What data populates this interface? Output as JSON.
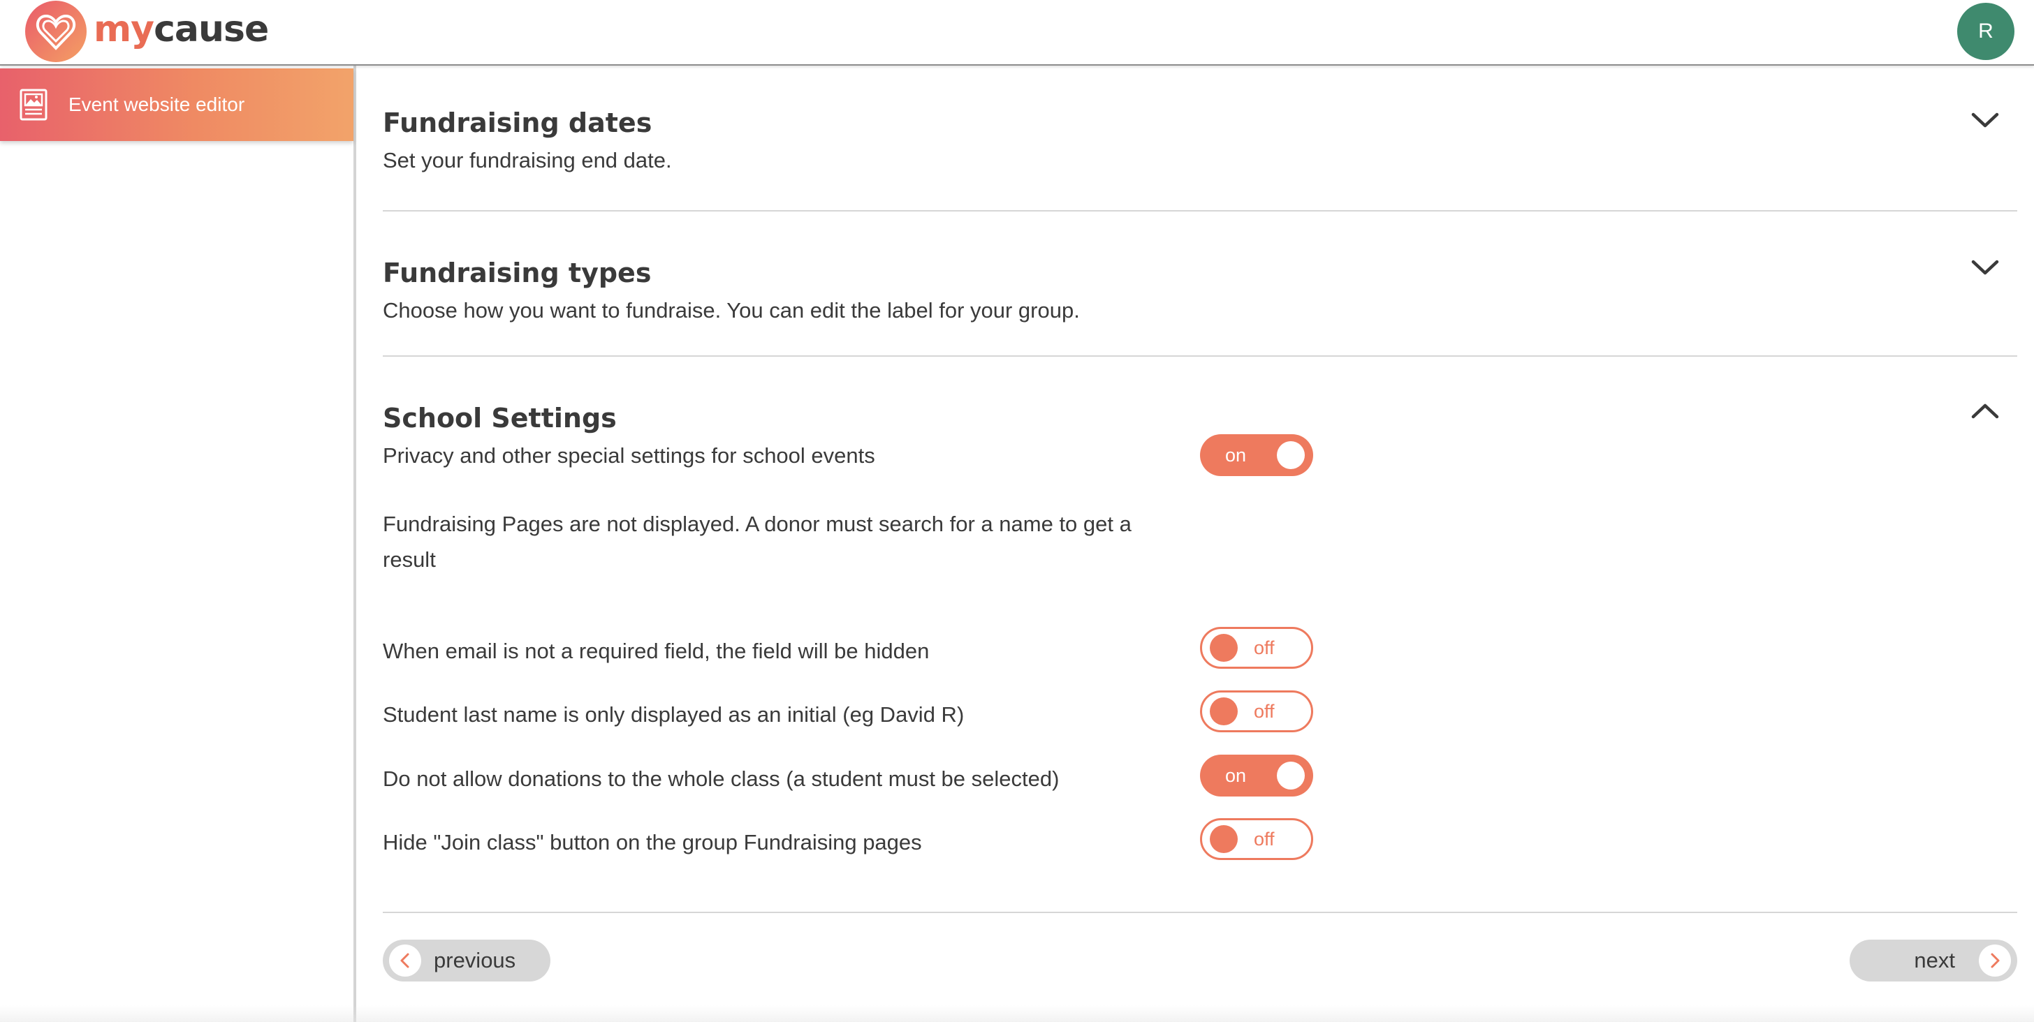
{
  "header": {
    "logo_my": "my",
    "logo_cause": "cause",
    "avatar_initial": "R"
  },
  "sidebar": {
    "items": [
      {
        "label": "Event website editor",
        "icon": "image-document-icon",
        "active": true
      }
    ]
  },
  "sections": [
    {
      "title": "Fundraising dates",
      "description": "Set your fundraising end date.",
      "expanded": false,
      "icon": "chevron-down-icon"
    },
    {
      "title": "Fundraising types",
      "description": "Choose how you want to fundraise. You can edit the label for your group.",
      "expanded": false,
      "icon": "chevron-down-icon"
    },
    {
      "title": "School Settings",
      "description": "Privacy and other special settings for school events",
      "expanded": true,
      "icon": "chevron-up-icon",
      "settings": [
        {
          "label": "Fundraising Pages are not displayed. A donor must search for a name to get a result",
          "state": "on"
        },
        {
          "label": "When email is not a required field, the field will be hidden",
          "state": "off"
        },
        {
          "label": "Student last name is only displayed as an initial (eg David R)",
          "state": "off"
        },
        {
          "label": "Do not allow donations to the whole class (a student must be selected)",
          "state": "on"
        },
        {
          "label": "Hide \"Join class\" button on the group Fundraising pages",
          "state": "off"
        }
      ]
    }
  ],
  "navigation": {
    "previous_label": "previous",
    "next_label": "next"
  },
  "colors": {
    "accent": "#ee7a5e",
    "avatar": "#3f8a6e",
    "sidebar_gradient_start": "#e8616b",
    "sidebar_gradient_end": "#f2a36a",
    "nav_button": "#d7d7d7"
  }
}
